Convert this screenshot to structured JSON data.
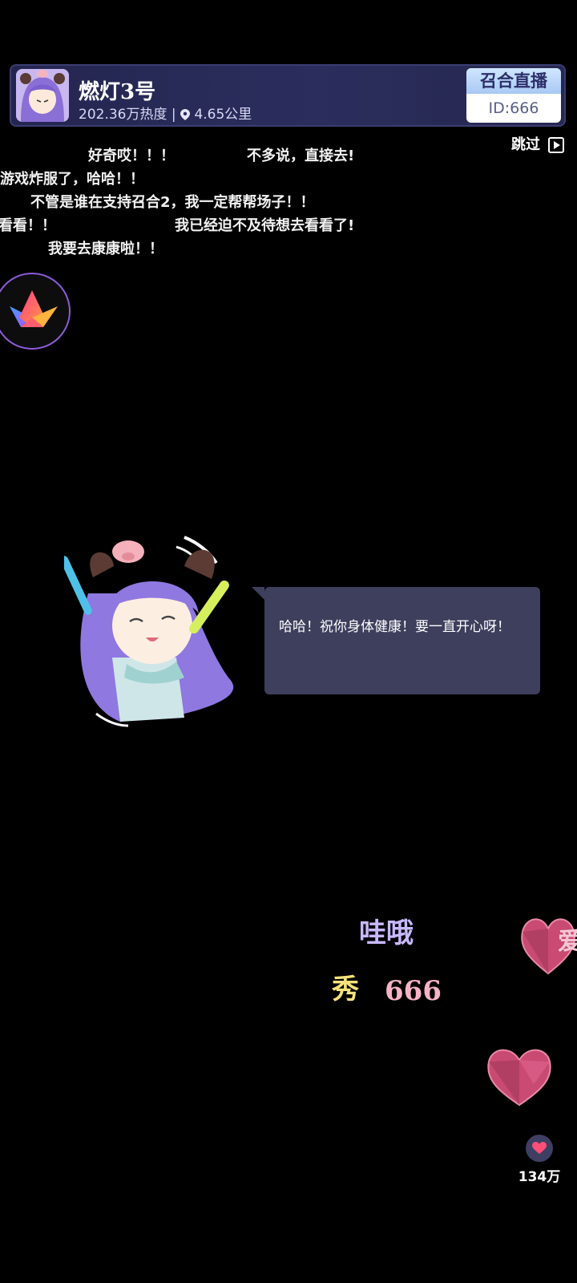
{
  "streamer": {
    "name": "燃灯3号",
    "popularity": "202.36万热度",
    "separator": "|",
    "distance": "4.65公里"
  },
  "brand": {
    "title": "召合直播",
    "id_label": "ID:666"
  },
  "skip_label": "跳过",
  "danmu": [
    "好奇哎！！！",
    "不多说，直接去!",
    "游戏炸服了，哈哈！！",
    "不管是谁在支持召合2，我一定帮帮场子！！",
    "看看！！",
    "我已经迫不及待想去看看了!",
    "我要去康康啦！！"
  ],
  "speech_bubble": "哈哈！祝你身体健康！要一直开心呀！",
  "floating": {
    "wow": "哇哦",
    "show": "秀",
    "six": "666",
    "love_partial": "爱"
  },
  "likes": {
    "count": "134万"
  },
  "colors": {
    "bar_bg": "#2b2d5d",
    "bubble_bg": "#3d3f5c",
    "wow_color": "#c9b8ff",
    "show_color": "#f6e27a",
    "six_color": "#f7b3c6",
    "heart_color": "#d9487a"
  }
}
